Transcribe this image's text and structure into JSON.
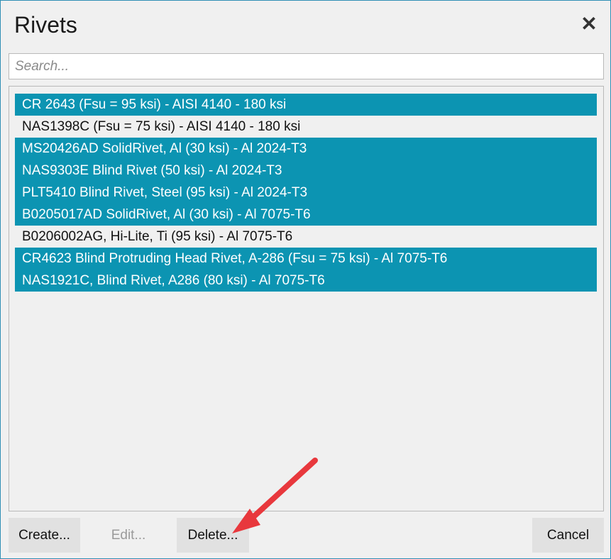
{
  "dialog": {
    "title": "Rivets",
    "close_glyph": "✕"
  },
  "search": {
    "placeholder": "Search...",
    "value": ""
  },
  "list": {
    "items": [
      {
        "label": "CR 2643 (Fsu = 95 ksi) - AISI 4140 - 180 ksi",
        "selected": true
      },
      {
        "label": "NAS1398C (Fsu = 75 ksi) - AISI 4140 - 180 ksi",
        "selected": false
      },
      {
        "label": "MS20426AD SolidRivet, Al (30 ksi) - Al 2024-T3",
        "selected": true
      },
      {
        "label": "NAS9303E Blind Rivet (50 ksi) - Al 2024-T3",
        "selected": true
      },
      {
        "label": "PLT5410 Blind Rivet, Steel (95 ksi) - Al 2024-T3",
        "selected": true
      },
      {
        "label": "B0205017AD SolidRivet, Al (30 ksi) - Al 7075-T6",
        "selected": true
      },
      {
        "label": "B0206002AG, Hi-Lite, Ti (95 ksi) - Al 7075-T6",
        "selected": false
      },
      {
        "label": "CR4623 Blind Protruding Head Rivet, A-286 (Fsu = 75 ksi) - Al 7075-T6",
        "selected": true
      },
      {
        "label": "NAS1921C, Blind Rivet, A286 (80 ksi) - Al 7075-T6",
        "selected": true
      }
    ]
  },
  "buttons": {
    "create": "Create...",
    "edit": "Edit...",
    "delete": "Delete...",
    "cancel": "Cancel"
  },
  "icons": {
    "close": "close-icon",
    "annotation": "arrow-icon"
  },
  "colors": {
    "selection": "#0c94b2",
    "arrow": "#e8383d"
  }
}
